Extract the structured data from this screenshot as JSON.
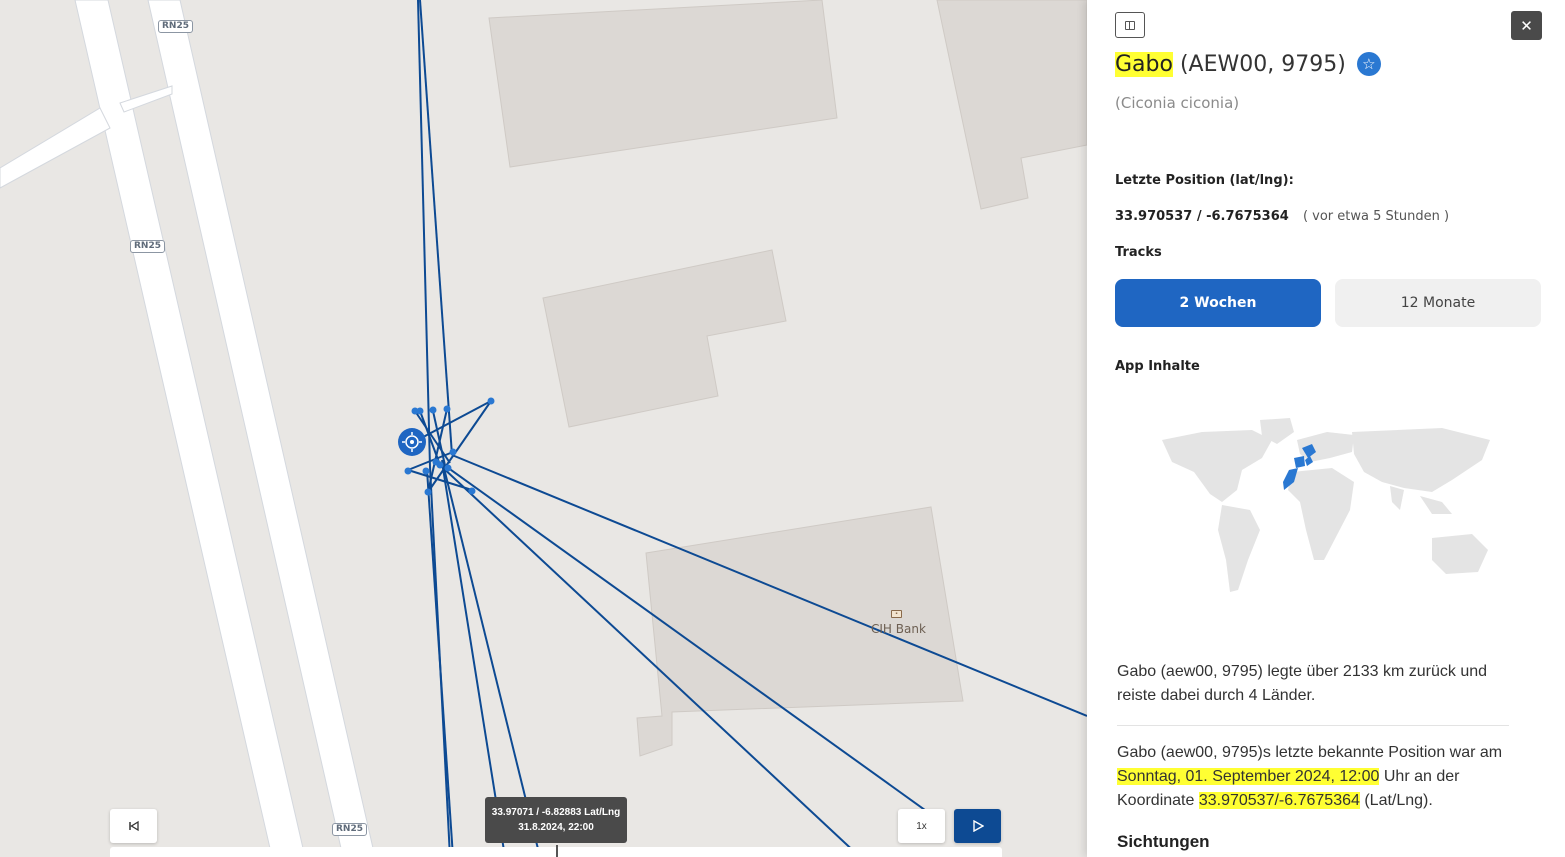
{
  "map": {
    "road_labels": [
      "RN25",
      "RN25",
      "RN25"
    ],
    "poi": {
      "label": "CIH Bank",
      "icon": "bank-icon"
    },
    "tooltip": {
      "coords": "33.97071 / -6.82883 Lat/Lng",
      "date": "31.8.2024, 22:00"
    },
    "controls": {
      "rewind_icon": "skip-back-icon",
      "speed_label": "1x",
      "play_icon": "play-icon"
    },
    "track_color": "#0d4a93",
    "point_color": "#2a78d2"
  },
  "panel": {
    "title_name": "Gabo",
    "title_ids": "(AEW00, 9795)",
    "species": "(Ciconia ciconia)",
    "last_position_label": "Letzte Position (lat/lng):",
    "last_position_value": "33.970537 / -6.7675364",
    "last_position_ago": "( vor etwa 5 Stunden )",
    "tracks_label": "Tracks",
    "tracks": [
      {
        "label": "2 Wochen",
        "active": true
      },
      {
        "label": "12 Monate",
        "active": false
      }
    ],
    "app_content_label": "App Inhalte",
    "summary_text": "Gabo (aew00, 9795) legte über 2133 km zurück und reiste dabei durch 4 Länder.",
    "last_known": {
      "prefix": "Gabo (aew00, 9795)s letzte bekannte Position war am ",
      "date": "Sonntag, 01. September 2024, 12:00",
      "mid": " Uhr an der Koordinate ",
      "coord": "33.970537/-6.7675364",
      "suffix": " (Lat/Lng)."
    },
    "sightings_label": "Sichtungen",
    "accent_color": "#1f66c2",
    "highlight_color": "#ffff33"
  }
}
